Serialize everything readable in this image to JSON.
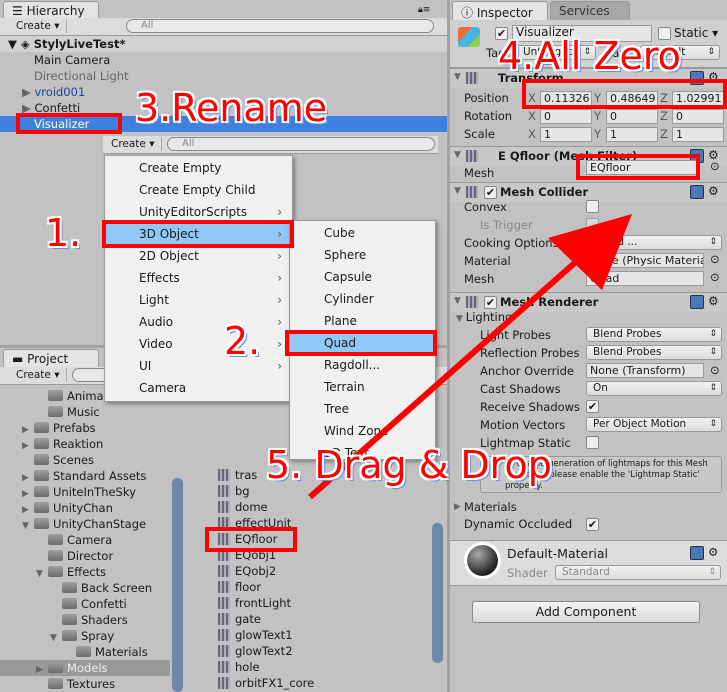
{
  "colors": {
    "selection": "#3d80df",
    "menu_highlight": "#90c8f6",
    "annotation": "#ff0000"
  },
  "hierarchy": {
    "tab": "Hierarchy",
    "create": "Create",
    "search_placeholder": "All",
    "scene": "StylyLiveTest*",
    "items": [
      {
        "label": "Main Camera"
      },
      {
        "label": "Directional Light"
      },
      {
        "label": "vroid001"
      },
      {
        "label": "Confetti"
      },
      {
        "label": "Visualizer"
      }
    ],
    "sub_create": "Create",
    "sub_search": "All"
  },
  "create_menu": {
    "items": [
      {
        "label": "Create Empty",
        "submenu": false
      },
      {
        "label": "Create Empty Child",
        "submenu": false
      },
      {
        "label": "UnityEditorScripts",
        "submenu": true
      },
      {
        "label": "3D Object",
        "submenu": true,
        "selected": true
      },
      {
        "label": "2D Object",
        "submenu": true
      },
      {
        "label": "Effects",
        "submenu": true
      },
      {
        "label": "Light",
        "submenu": true
      },
      {
        "label": "Audio",
        "submenu": true
      },
      {
        "label": "Video",
        "submenu": true
      },
      {
        "label": "UI",
        "submenu": true
      },
      {
        "label": "Camera",
        "submenu": false
      }
    ]
  },
  "object_submenu": {
    "items": [
      {
        "label": "Cube"
      },
      {
        "label": "Sphere"
      },
      {
        "label": "Capsule"
      },
      {
        "label": "Cylinder"
      },
      {
        "label": "Plane"
      },
      {
        "label": "Quad",
        "selected": true
      },
      {
        "label": "Ragdoll..."
      },
      {
        "label": "Terrain"
      },
      {
        "label": "Tree"
      },
      {
        "label": "Wind Zone"
      },
      {
        "label": "3D Text"
      }
    ]
  },
  "project": {
    "tab": "Project",
    "create": "Create",
    "tree": [
      {
        "label": "Anima",
        "depth": 3
      },
      {
        "label": "Music",
        "depth": 3
      },
      {
        "label": "Prefabs",
        "depth": 2,
        "arrow": "right"
      },
      {
        "label": "Reaktion",
        "depth": 2,
        "arrow": "right"
      },
      {
        "label": "Scenes",
        "depth": 2
      },
      {
        "label": "Standard Assets",
        "depth": 2,
        "arrow": "right"
      },
      {
        "label": "UniteInTheSky",
        "depth": 2,
        "arrow": "right"
      },
      {
        "label": "UnityChan",
        "depth": 2,
        "arrow": "right"
      },
      {
        "label": "UnityChanStage",
        "depth": 2,
        "arrow": "down"
      },
      {
        "label": "Camera",
        "depth": 3
      },
      {
        "label": "Director",
        "depth": 3
      },
      {
        "label": "Effects",
        "depth": 3,
        "arrow": "down"
      },
      {
        "label": "Back Screen",
        "depth": 4
      },
      {
        "label": "Confetti",
        "depth": 4
      },
      {
        "label": "Shaders",
        "depth": 4
      },
      {
        "label": "Spray",
        "depth": 4,
        "arrow": "down"
      },
      {
        "label": "Materials",
        "depth": 5
      },
      {
        "label": "Models",
        "depth": 3,
        "arrow": "right",
        "selected": true
      },
      {
        "label": "Textures",
        "depth": 3
      }
    ],
    "assets": [
      "tras",
      "bg",
      "dome",
      "effectUnit",
      "EQfloor",
      "EQobj1",
      "EQobj2",
      "floor",
      "frontLight",
      "gate",
      "glowText1",
      "glowText2",
      "hole",
      "orbitFX1_core"
    ]
  },
  "inspector": {
    "tab": "Inspector",
    "services_tab": "Services",
    "name": "Visualizer",
    "static": "Static",
    "tag_label": "Tag",
    "tag": "Untagged",
    "layer_label": "Layer",
    "layer": "Default",
    "transform": {
      "title": "Transform",
      "position_label": "Position",
      "rotation_label": "Rotation",
      "scale_label": "Scale",
      "position": [
        "0.11326",
        "0.48649",
        "1.02991"
      ],
      "rotation": [
        "0",
        "0",
        "0"
      ],
      "scale": [
        "1",
        "1",
        "1"
      ],
      "axes": [
        "X",
        "Y",
        "Z"
      ]
    },
    "mesh_filter": {
      "title": "E Qfloor (Mesh Filter)",
      "mesh_label": "Mesh",
      "mesh": "EQfloor"
    },
    "mesh_collider": {
      "title": "Mesh Collider",
      "convex": "Convex",
      "is_trigger": "Is Trigger",
      "cooking": "Cooking Options",
      "cooking_value": "Mixed ...",
      "material": "Material",
      "material_value": "None (Physic Material)",
      "mesh": "Mesh",
      "mesh_value": "Quad"
    },
    "mesh_renderer": {
      "title": "Mesh Renderer",
      "lighting": "Lighting",
      "light_probes": "Light Probes",
      "light_probes_value": "Blend Probes",
      "reflection_probes": "Reflection Probes",
      "reflection_probes_value": "Blend Probes",
      "anchor": "Anchor Override",
      "anchor_value": "None (Transform)",
      "cast": "Cast Shadows",
      "cast_value": "On",
      "receive": "Receive Shadows",
      "motion": "Motion Vectors",
      "motion_value": "Per Object Motion",
      "lightmap_static": "Lightmap Static",
      "info": "To enable generation of lightmaps for this Mesh Renderer, please enable the 'Lightmap Static' property.",
      "materials": "Materials",
      "dynamic": "Dynamic Occluded"
    },
    "material": {
      "name": "Default-Material",
      "shader_label": "Shader",
      "shader": "Standard"
    },
    "add_component": "Add Component"
  },
  "annotations": {
    "step1": "1.",
    "step2": "2.",
    "step3": "3.Rename",
    "step4": "4.All Zero",
    "step5": "5. Drag & Drop"
  }
}
